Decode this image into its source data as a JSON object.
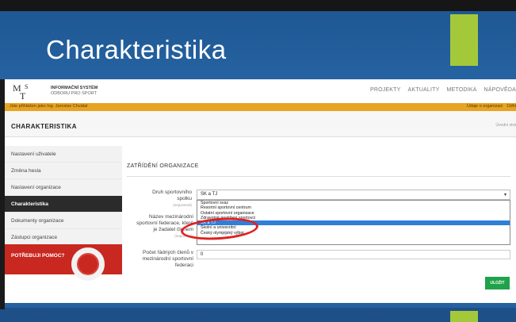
{
  "slide": {
    "title": "Charakteristika",
    "accent_color": "#a3c93b",
    "background_color": "#2c6cad"
  },
  "site": {
    "logo_line1": "INFORMAČNÍ SYSTÉM",
    "logo_line2": "ODBORU PRO SPORT",
    "nav": [
      "PROJEKTY",
      "AKTUALITY",
      "METODIKA",
      "NÁPOVĚDA"
    ],
    "userbar_left": "Jste přihlášen jako Ing. Jaroslav Chvátal",
    "userbar_right": [
      "Údaje o organizaci",
      "Odhl"
    ],
    "userbar_color": "#e7a322"
  },
  "page": {
    "title": "CHARAKTERISTIKA",
    "breadcrumb": "Úvodní strá"
  },
  "sidebar": {
    "items": [
      {
        "label": "Nastavení uživatele",
        "active": false
      },
      {
        "label": "Změna hesla",
        "active": false
      },
      {
        "label": "Nastavení organizace",
        "active": false
      },
      {
        "label": "Charakteristika",
        "active": true
      },
      {
        "label": "Dokumenty organizace",
        "active": false
      },
      {
        "label": "Zástupci organizace",
        "active": false
      }
    ],
    "help_label": "POTŘEBUJI POMOC?"
  },
  "form": {
    "section_title": "ZATŘÍDĚNÍ ORGANIZACE",
    "field1_label": "Druh sportovního spolku",
    "field1_hint": "(nepovinné)",
    "field1_value": "SK a TJ",
    "options": [
      "Sportovní svaz",
      "Resortní sportovní centrum",
      "Ostatní sportovní organizace",
      "Zdravotně postižení sportovci",
      "SK a TJ",
      "Školní a univerzitní",
      "Český olympijský výbor"
    ],
    "selected_option": 4,
    "field2_label": "Název mezinárodní sportovní federace, které je žadatel členem",
    "field2_hint": "(nepovinné)",
    "field3_label": "Počet řádných členů v mezinárodní sportovní federaci",
    "field3_value": "0",
    "save_label": "ULOŽIT",
    "save_color": "#1fa24a"
  }
}
